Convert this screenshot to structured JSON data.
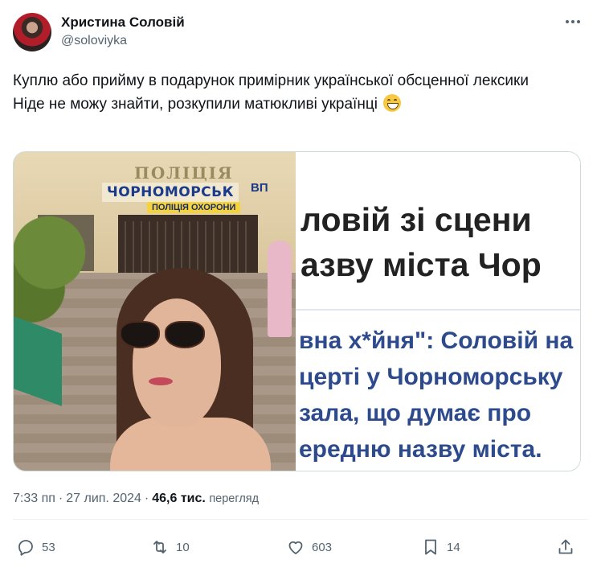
{
  "author": {
    "name": "Христина Соловій",
    "handle": "@soloviyka"
  },
  "tweet": {
    "line1": "Куплю або прийму в подарунок примірник української обсценної лексики",
    "line2": "Ніде не можу знайти, розкупили матюкливі українці"
  },
  "media": {
    "photo_sign_top": "ПОЛІЦІЯ",
    "photo_sign_city": "ЧОРНОМОРСЬК",
    "photo_sign_vp": "ВП",
    "photo_sign_guard": "ПОЛІЦІЯ ОХОРОНИ",
    "headline_1": "ловій зі сцени",
    "headline_2": "азву міста Чор",
    "sub_1": "вна х*йня\": Соловій на",
    "sub_2": "церті у Чорноморську",
    "sub_3": "зала, що думає про",
    "sub_4": "ередню назву міста."
  },
  "meta": {
    "time": "7:33 пп",
    "date": "27 лип. 2024",
    "views": "46,6 тис.",
    "views_label": "перегляд"
  },
  "actions": {
    "replies": "53",
    "retweets": "10",
    "likes": "603",
    "bookmarks": "14"
  },
  "icons": [
    "reply-icon",
    "retweet-icon",
    "like-icon",
    "bookmark-icon",
    "share-icon",
    "more-icon",
    "grin-emoji-icon"
  ]
}
